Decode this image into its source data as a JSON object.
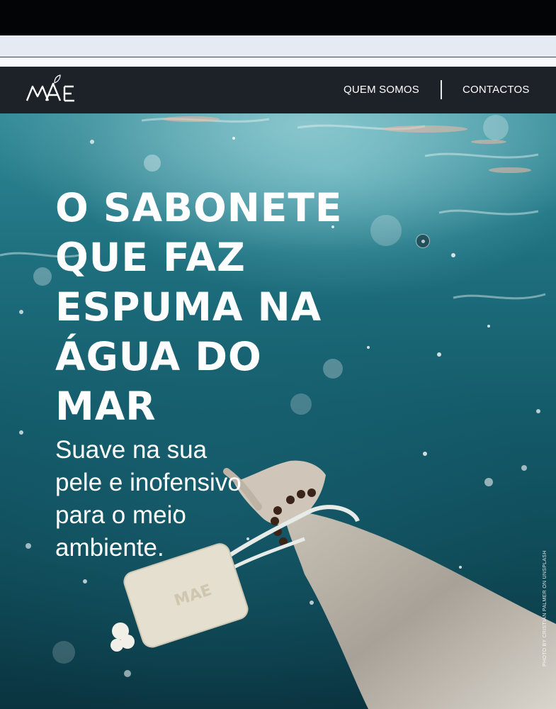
{
  "brand": {
    "logo_text": "MAE"
  },
  "nav": {
    "items": [
      {
        "label": "QUEM SOMOS"
      },
      {
        "label": "CONTACTOS"
      }
    ]
  },
  "hero": {
    "headline_lines": [
      "O SABONETE",
      "QUE FAZ",
      "ESPUMA NA",
      "ÁGUA DO",
      "MAR"
    ],
    "subline_lines": [
      "Suave na sua",
      "pele e inofensivo",
      "para o meio",
      "ambiente."
    ],
    "photo_credit": "PHOTO BY CRISTIAN PALMER ON UNSPLASH",
    "image_subject": "underwater-arm-holding-soap-bar"
  },
  "colors": {
    "navbar": "#1c2228",
    "water_light": "#2f8896",
    "water_dark": "#0a3440",
    "text": "#ffffff"
  }
}
